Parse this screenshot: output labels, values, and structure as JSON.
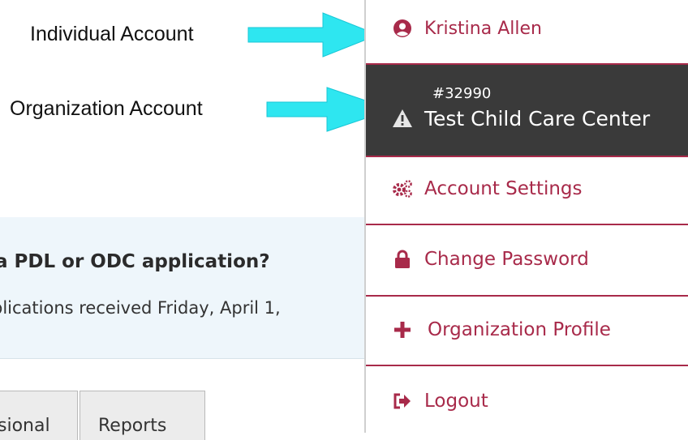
{
  "annotations": {
    "individual_label": "Individual Account",
    "organization_label": "Organization  Account",
    "arrow_color": "#2ee6f0"
  },
  "background": {
    "notice_title": "a PDL or ODC application?",
    "notice_body": "plications received Friday, April 1,",
    "tabs": [
      {
        "label": "sional"
      },
      {
        "label": "Reports"
      }
    ]
  },
  "menu": {
    "accent_color": "#a82a4a",
    "user": {
      "name": "Kristina Allen",
      "icon": "user-circle-icon"
    },
    "organization": {
      "id": "#32990",
      "name": "Test Child Care Center",
      "icon": "warning-icon"
    },
    "items": [
      {
        "label": "Account Settings",
        "icon": "gears-icon"
      },
      {
        "label": "Change Password",
        "icon": "lock-icon"
      },
      {
        "label": "Organization Profile",
        "icon": "plus-icon"
      },
      {
        "label": "Logout",
        "icon": "sign-out-icon"
      }
    ]
  }
}
